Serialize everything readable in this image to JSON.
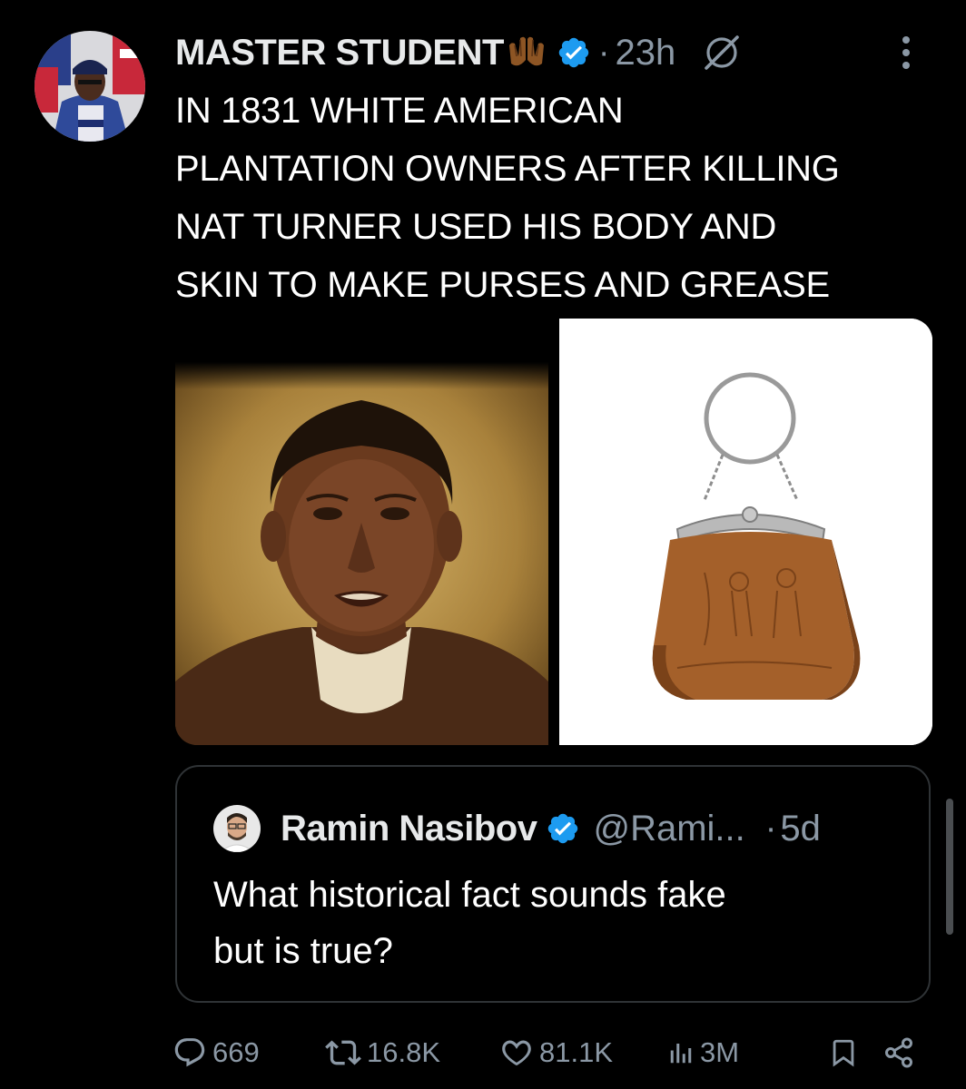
{
  "post": {
    "author_name": "MASTER STUDENT",
    "author_emoji": "palms-up-together-medium-dark-skin-emoji",
    "verified": true,
    "separator": "·",
    "time": "23h",
    "text": "IN 1831 WHITE AMERICAN\nPLANTATION OWNERS AFTER KILLING\nNAT TURNER USED HIS BODY AND\nSKIN TO MAKE PURSES AND GREASE",
    "media": [
      {
        "icon": "portrait-painting-image",
        "description_visible": false
      },
      {
        "icon": "leather-purse-photo",
        "description_visible": false
      }
    ]
  },
  "quoted_post": {
    "author_name": "Ramin Nasibov",
    "verified": true,
    "handle": "@Rami...",
    "separator": "·",
    "time": "5d",
    "text": "What historical fact sounds fake\nbut is true?"
  },
  "actions": {
    "replies": "669",
    "reposts": "16.8K",
    "likes": "81.1K",
    "views": "3M"
  },
  "icons": {
    "reply": "speech-bubble-icon",
    "repost": "repost-arrows-icon",
    "like": "heart-icon",
    "views": "bar-chart-icon",
    "bookmark": "bookmark-icon",
    "share": "share-nodes-icon",
    "grok": "grok-slash-icon",
    "more": "more-vertical-icon"
  },
  "colors": {
    "background": "#000000",
    "text_primary": "#ffffff",
    "text_secondary": "#8b98a5",
    "verified_blue": "#1d9bf0",
    "border": "#2f3336"
  }
}
